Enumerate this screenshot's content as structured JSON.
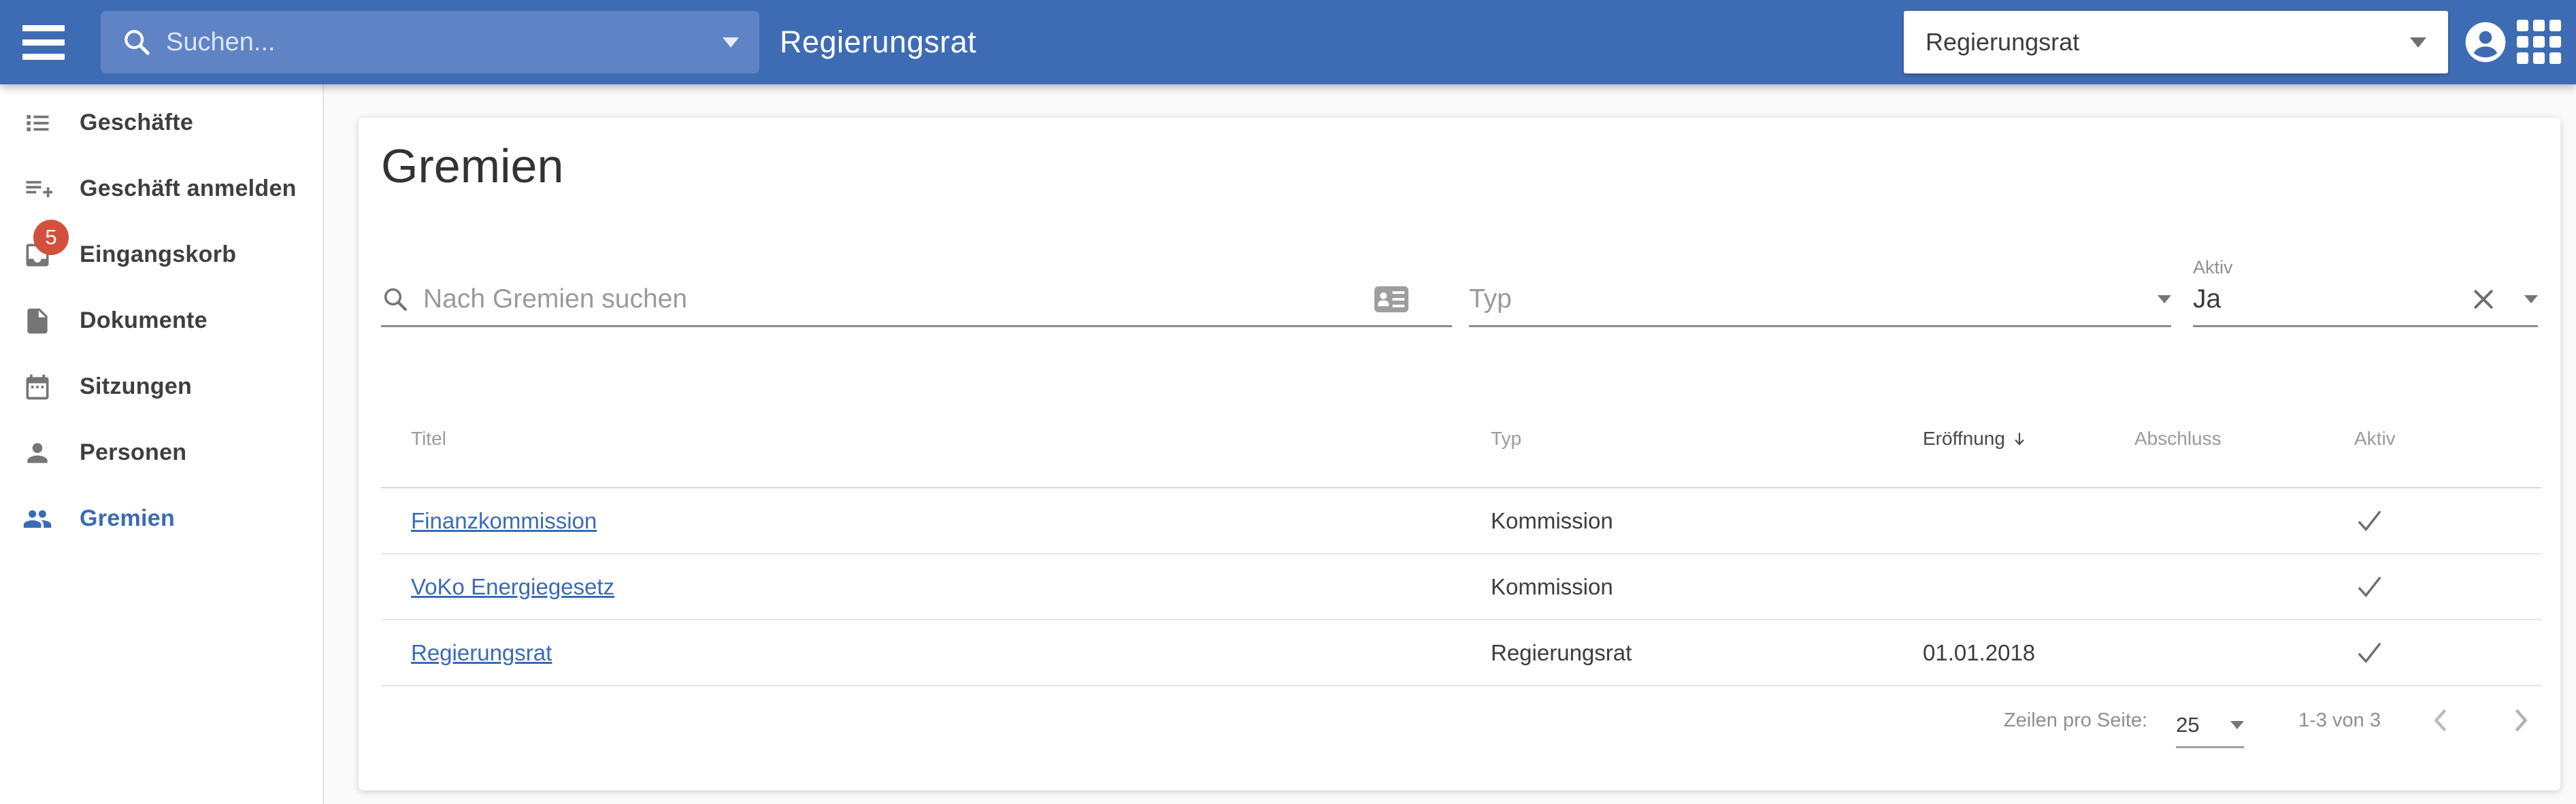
{
  "header": {
    "search_placeholder": "Suchen...",
    "title": "Regierungsrat",
    "context_select_value": "Regierungsrat"
  },
  "sidebar": {
    "items": [
      {
        "label": "Geschäfte",
        "icon": "list-icon",
        "active": false
      },
      {
        "label": "Geschäft anmelden",
        "icon": "playlist-add-icon",
        "active": false
      },
      {
        "label": "Eingangskorb",
        "icon": "inbox-icon",
        "active": false,
        "badge": "5"
      },
      {
        "label": "Dokumente",
        "icon": "document-icon",
        "active": false
      },
      {
        "label": "Sitzungen",
        "icon": "calendar-icon",
        "active": false
      },
      {
        "label": "Personen",
        "icon": "person-icon",
        "active": false
      },
      {
        "label": "Gremien",
        "icon": "people-icon",
        "active": true
      }
    ]
  },
  "main": {
    "page_title": "Gremien",
    "filters": {
      "search_placeholder": "Nach Gremien suchen",
      "typ_placeholder": "Typ",
      "aktiv_label": "Aktiv",
      "aktiv_value": "Ja"
    },
    "table": {
      "columns": [
        "Titel",
        "Typ",
        "Eröffnung",
        "Abschluss",
        "Aktiv"
      ],
      "sort_column": "Eröffnung",
      "sort_direction": "desc",
      "rows": [
        {
          "titel": "Finanzkommission",
          "typ": "Kommission",
          "eroeffnung": "",
          "abschluss": "",
          "aktiv": true
        },
        {
          "titel": "VoKo Energiegesetz",
          "typ": "Kommission",
          "eroeffnung": "",
          "abschluss": "",
          "aktiv": true
        },
        {
          "titel": "Regierungsrat",
          "typ": "Regierungsrat",
          "eroeffnung": "01.01.2018",
          "abschluss": "",
          "aktiv": true
        }
      ]
    },
    "pagination": {
      "rows_per_page_label": "Zeilen pro Seite:",
      "rows_per_page_value": "25",
      "range_label": "1-3 von 3"
    }
  },
  "colors": {
    "header_blue": "#3e6cb4",
    "header_search_blue": "#5f83c5",
    "accent_blue": "#3a6bb5",
    "badge_red": "#d2503e",
    "icon_grey": "#757575",
    "muted_text": "#9b9b9b",
    "body_text": "#3d3d3d",
    "divider": "#e6e6e6",
    "background": "#fafafa"
  }
}
